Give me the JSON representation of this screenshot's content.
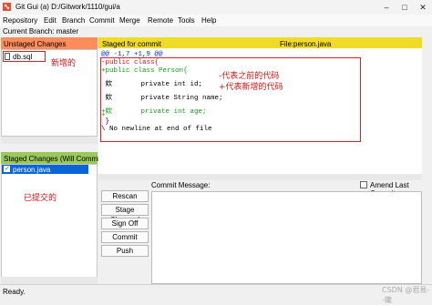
{
  "window": {
    "title": "Git Gui (a) D:/Gitwork/1110/gui/a",
    "minimize": "–",
    "maximize": "□",
    "close": "✕"
  },
  "menu": [
    "Repository",
    "Edit",
    "Branch",
    "Commit",
    "Merge",
    "Remote",
    "Tools",
    "Help"
  ],
  "branch_line": "Current Branch: master",
  "unstaged": {
    "title": "Unstaged Changes",
    "files": [
      "db.sql"
    ]
  },
  "staged": {
    "title": "Staged Changes (Will Commit)",
    "files": [
      "person.java"
    ],
    "check": "✓"
  },
  "diff": {
    "title": "Staged for commit",
    "file_label": "File:",
    "file_name": "person.java",
    "lines": [
      "@@ -1,7 +1,9 @@",
      "-public class{",
      "+public class Person{",
      "",
      " 欸       private int id;",
      "",
      " 欸       private String name;",
      "",
      "+欸       private int age;",
      "+",
      " }",
      "\\ No newline at end of file"
    ]
  },
  "annotations": {
    "new_file": "新增的",
    "minus_note": "-代表之前的代码",
    "plus_note": "+代表新增的代码",
    "committed": "已提交的"
  },
  "commit": {
    "message_label": "Commit Message:",
    "amend_label": "Amend Last Commit",
    "buttons": [
      "Rescan",
      "Stage Changed",
      "Sign Off",
      "Commit",
      "Push"
    ]
  },
  "status": "Ready.",
  "watermark": "CSDN @君易--鑨",
  "colors": {
    "unstaged_header": "#ff8c5a",
    "staged_header": "#9ac85a",
    "diff_header": "#f0dc26",
    "annotation_red": "#d01010",
    "selection_blue": "#0a66d8"
  }
}
